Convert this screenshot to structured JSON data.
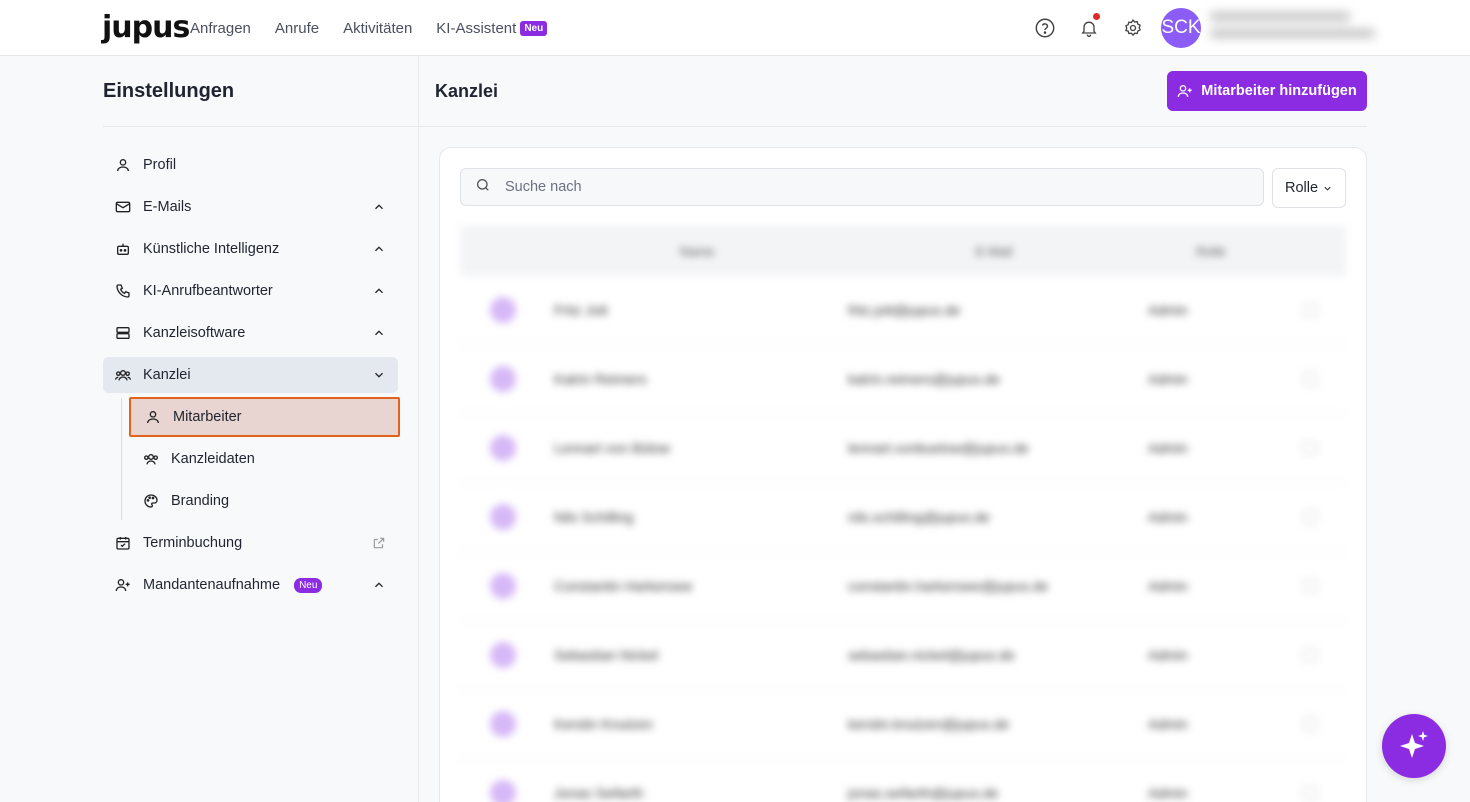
{
  "topbar": {
    "logo": "jupus",
    "nav": [
      "Anfragen",
      "Anrufe",
      "Aktivitäten",
      "KI-Assistent"
    ],
    "nav_badge": "Neu",
    "avatar_initials": "SCK"
  },
  "sidebar": {
    "title": "Einstellungen",
    "items": [
      {
        "label": "Profil",
        "icon": "user-icon"
      },
      {
        "label": "E-Mails",
        "icon": "mail-icon"
      },
      {
        "label": "Künstliche Intelligenz",
        "icon": "bot-icon"
      },
      {
        "label": "KI-Anrufbeantworter",
        "icon": "phone-icon"
      },
      {
        "label": "Kanzleisoftware",
        "icon": "server-icon"
      },
      {
        "label": "Kanzlei",
        "icon": "users-icon"
      },
      {
        "label": "Terminbuchung",
        "icon": "calendar-check-icon"
      },
      {
        "label": "Mandantenaufnahme",
        "icon": "user-plus-icon",
        "badge": "Neu"
      }
    ],
    "sub_items": [
      {
        "label": "Mitarbeiter",
        "icon": "user-icon"
      },
      {
        "label": "Kanzleidaten",
        "icon": "users-icon"
      },
      {
        "label": "Branding",
        "icon": "palette-icon"
      }
    ]
  },
  "main": {
    "title": "Kanzlei",
    "add_button": "Mitarbeiter hinzufügen",
    "search_placeholder": "Suche nach",
    "role_filter": "Rolle",
    "table": {
      "headers": [
        "Name",
        "E-Mail",
        "Rolle"
      ],
      "rows": [
        {
          "name": "Fritz Jott",
          "email": "fritz.jott@jupus.de",
          "role": "Admin"
        },
        {
          "name": "Katrin Reimers",
          "email": "katrin.reimers@jupus.de",
          "role": "Admin"
        },
        {
          "name": "Lennart von Bülow",
          "email": "lennart.vonbuelow@jupus.de",
          "role": "Admin"
        },
        {
          "name": "Nils Schilling",
          "email": "nils.schilling@jupus.de",
          "role": "Admin"
        },
        {
          "name": "Constantin Harkensee",
          "email": "constantin.harkensee@jupus.de",
          "role": "Admin"
        },
        {
          "name": "Sebastian Nickel",
          "email": "sebastian.nickel@jupus.de",
          "role": "Admin"
        },
        {
          "name": "Kerstin Knutzen",
          "email": "kerstin.knutzen@jupus.de",
          "role": "Admin"
        },
        {
          "name": "Jonas Seifarth",
          "email": "jonas.seifarth@jupus.de",
          "role": "Admin"
        }
      ]
    }
  },
  "colors": {
    "accent": "#8b2be2",
    "highlight_border": "#e0621c"
  }
}
